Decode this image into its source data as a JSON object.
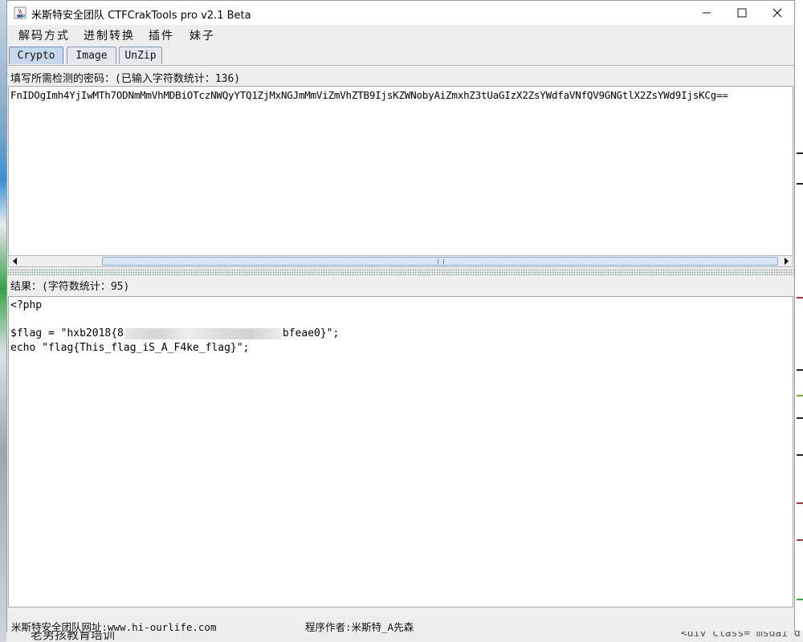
{
  "window": {
    "title": "米斯特安全团队 CTFCrakTools pro v2.1 Beta"
  },
  "menu": [
    "解码方式",
    "进制转换",
    "插件",
    "妹子"
  ],
  "tabs": [
    {
      "label": "Crypto",
      "active": true
    },
    {
      "label": "Image",
      "active": false
    },
    {
      "label": "UnZip",
      "active": false
    }
  ],
  "input": {
    "label": "填写所需检测的密码：(已输入字符数统计：136)",
    "value": "FnIDOgImh4YjIwMTh7ODNmMmVhMDBiOTczNWQyYTQ1ZjMxNGJmMmViZmVhZTB9IjsKZWNobyAiZmxhZ3tUaGIzX2ZsYWdfaVNfQV9GNGtlX2ZsYWd9IjsKCg=="
  },
  "output": {
    "label": "结果：(字符数统计：95)",
    "lines": {
      "l1": "<?php",
      "l2a": "$flag = \"hxb2018{8",
      "l2b": "bfeae0}\";",
      "l3": "echo \"flag{This_flag_iS_A_F4ke_flag}\";"
    }
  },
  "status": {
    "site": "米斯特安全团队网址:www.hi-ourlife.com",
    "author": "程序作者:米斯特_A先森"
  },
  "background": {
    "bottom_text": "老男孩教育培训",
    "bottom_code": "<div class= msdai d"
  }
}
